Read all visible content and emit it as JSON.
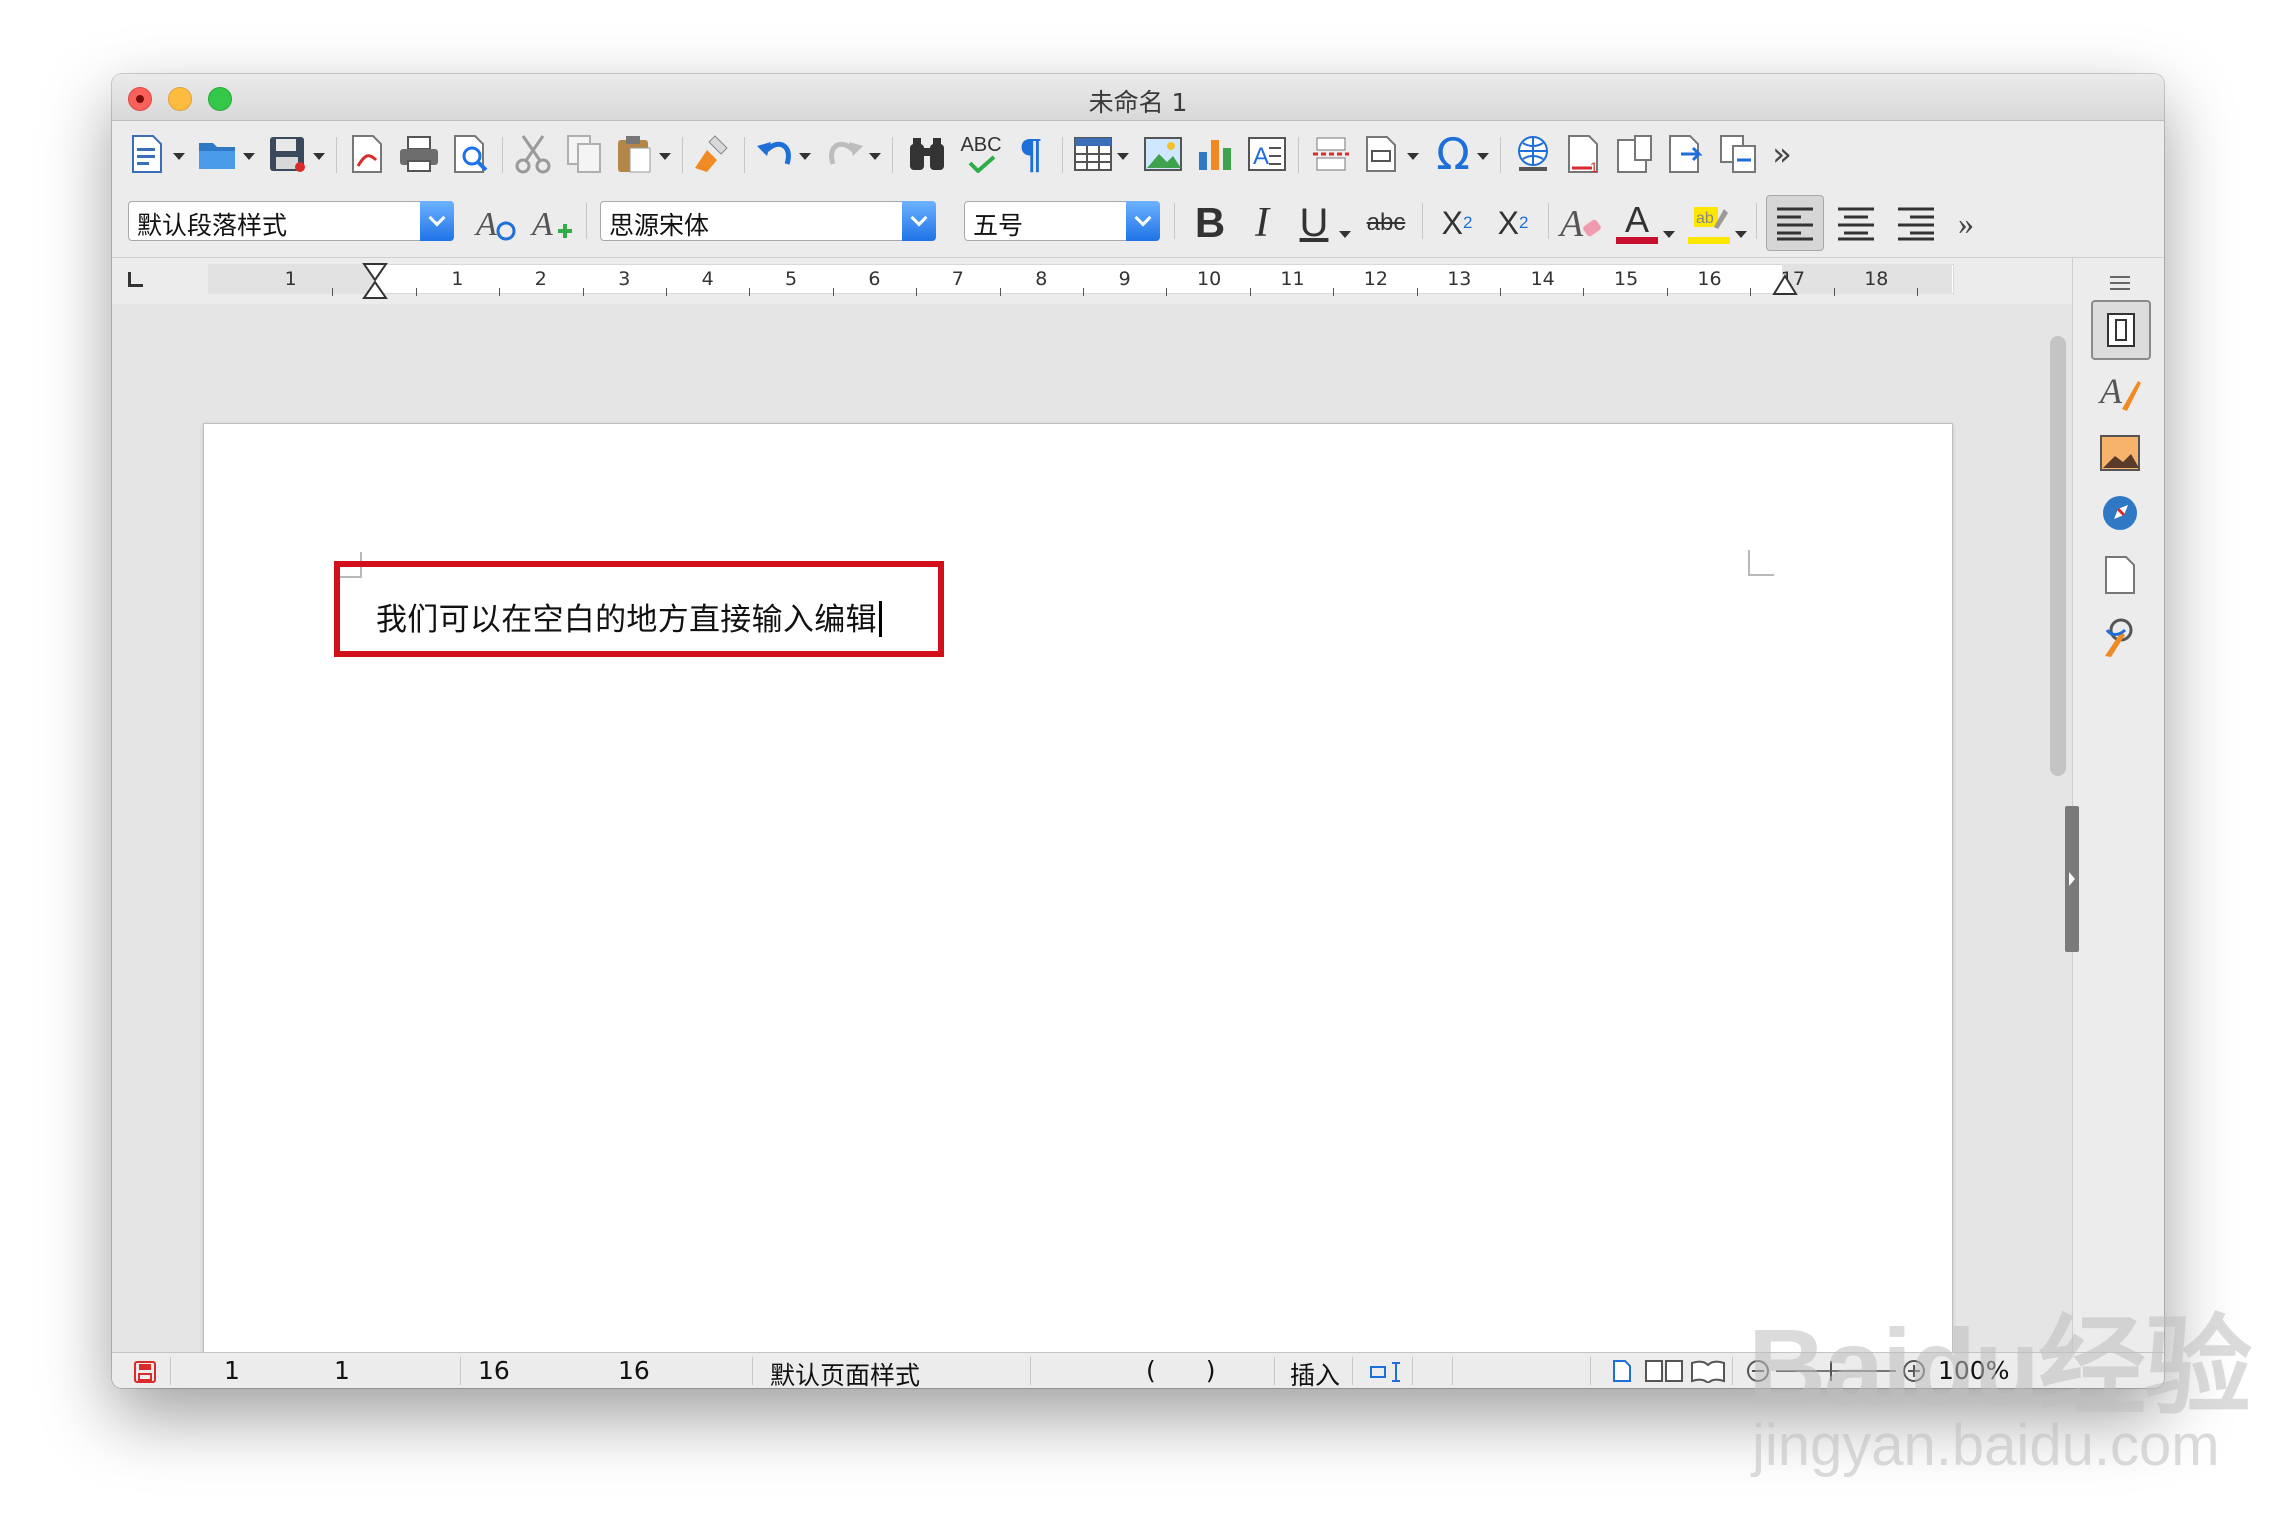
{
  "window": {
    "title": "未命名 1"
  },
  "toolbar": {
    "icons": [
      "new-document",
      "open-folder",
      "save",
      "export-pdf",
      "print",
      "print-preview",
      "cut",
      "copy",
      "paste",
      "clone-formatting",
      "undo",
      "redo",
      "find-replace",
      "spelling",
      "formatting-marks",
      "insert-table",
      "insert-image",
      "insert-chart",
      "insert-text-box",
      "page-break",
      "insert-field",
      "special-character",
      "hyperlink",
      "footnote",
      "comment",
      "track-changes",
      "compare",
      "more"
    ],
    "spelling_label": "ABC"
  },
  "formatting": {
    "paragraph_style": "默认段落样式",
    "font_name": "思源宋体",
    "font_size": "五号",
    "strikethrough_label": "abc",
    "colors": {
      "font_color": "#c8102e",
      "highlight": "#ffe600",
      "accent": "#1f73e8"
    }
  },
  "ruler": {
    "left_numbers": [
      "1"
    ],
    "numbers": [
      "1",
      "2",
      "3",
      "4",
      "5",
      "6",
      "7",
      "8",
      "9",
      "10",
      "11",
      "12",
      "13",
      "14",
      "15",
      "16",
      "17",
      "18"
    ]
  },
  "document": {
    "text": "我们可以在空白的地方直接输入编辑",
    "annotation_color": "#d1101c"
  },
  "statusbar": {
    "page": "1",
    "page_of": "1",
    "words": "16",
    "chars": "16",
    "page_style": "默认页面样式",
    "language": "(  )",
    "insert_mode": "插入",
    "zoom": "100%"
  },
  "watermark": {
    "brand": "Baidu经验",
    "url": "jingyan.baidu.com"
  }
}
